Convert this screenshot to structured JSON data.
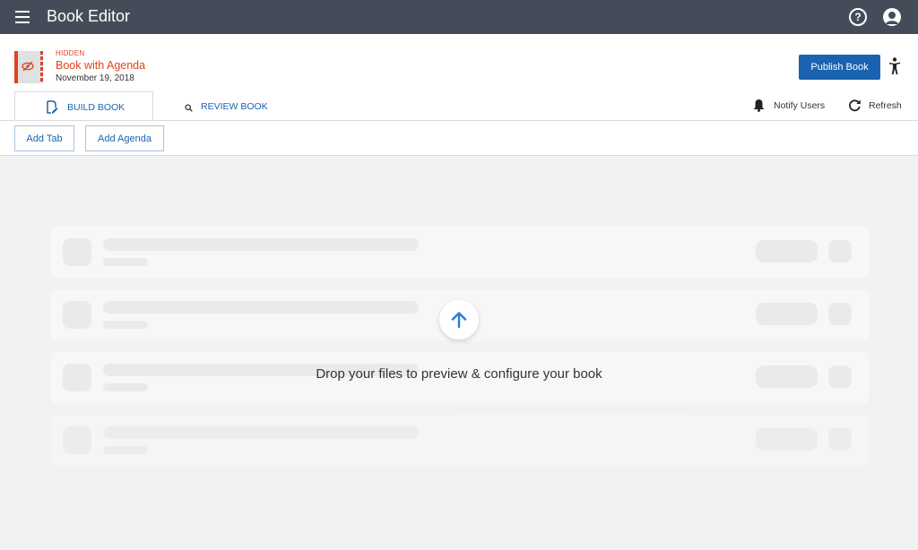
{
  "app": {
    "title": "Book Editor"
  },
  "book": {
    "status": "HIDDEN",
    "title": "Book with Agenda",
    "date": "November 19, 2018"
  },
  "actions": {
    "publish": "Publish Book",
    "notify": "Notify Users",
    "refresh": "Refresh",
    "add_tab": "Add Tab",
    "add_agenda": "Add Agenda"
  },
  "tabs": [
    {
      "label": "BUILD BOOK",
      "icon": "edit-document-icon",
      "active": true
    },
    {
      "label": "REVIEW BOOK",
      "icon": "search-icon",
      "active": false
    }
  ],
  "dropzone": {
    "message": "Drop your files to preview & configure your book",
    "icon": "arrow-up-icon"
  },
  "icons": {
    "menu": "hamburger-menu-icon",
    "help": "help-icon",
    "user": "user-avatar-icon",
    "accessibility": "accessibility-icon",
    "bell": "bell-icon",
    "refresh": "refresh-icon",
    "hidden": "eye-off-icon"
  },
  "colors": {
    "topbar": "#454c59",
    "accent": "#1a63b0",
    "hidden_status": "#e2401f",
    "background": "#f1f2f2"
  }
}
